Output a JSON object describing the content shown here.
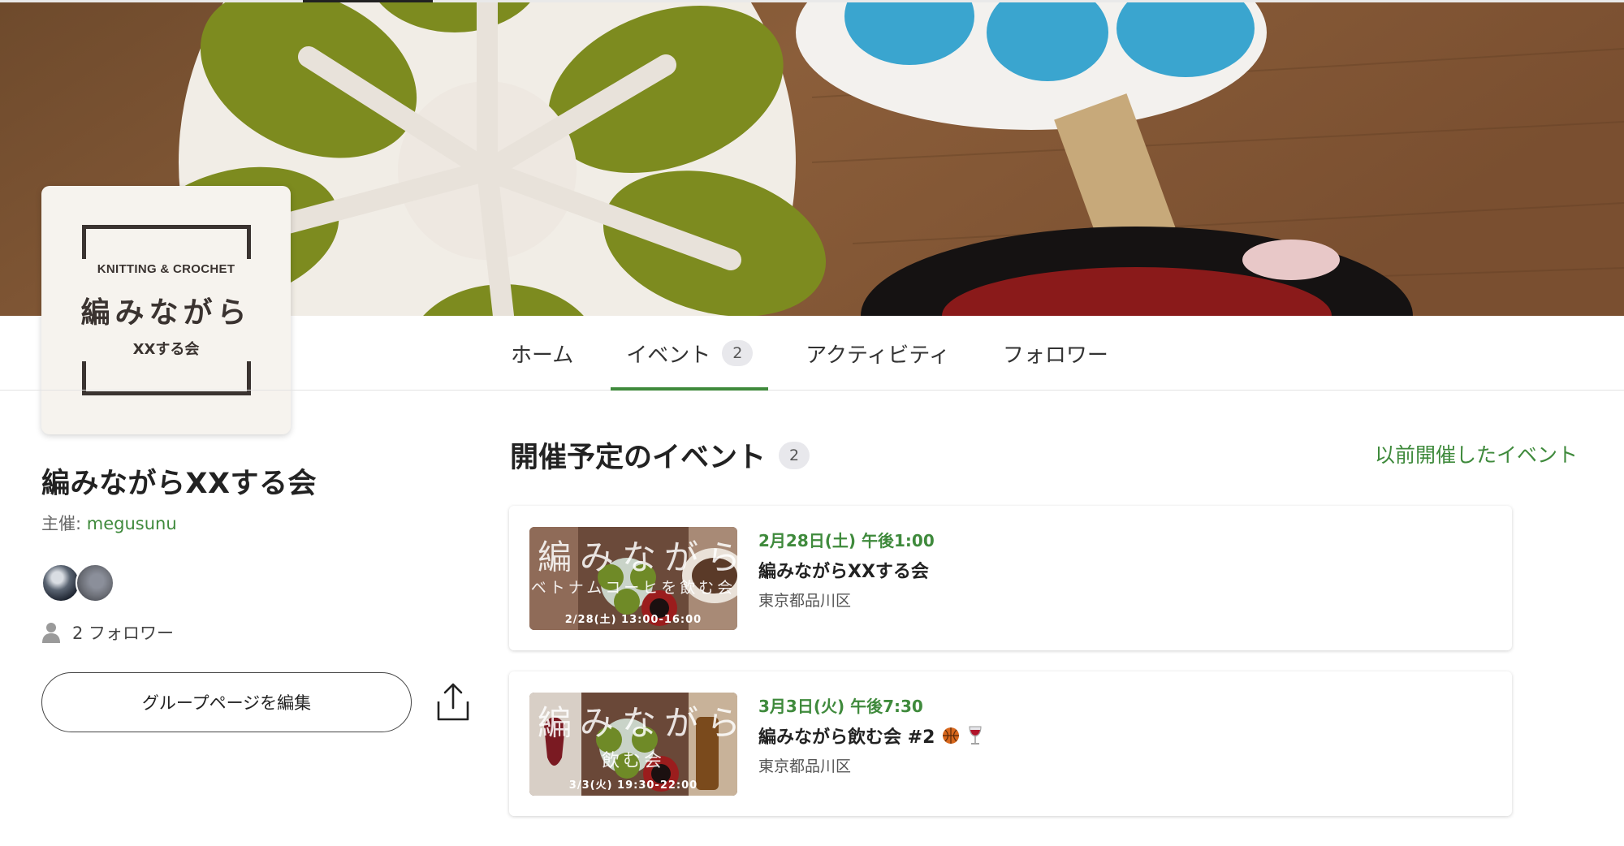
{
  "logo": {
    "line1": "KNITTING & CROCHET",
    "line2": "編みながら",
    "line3": "XXする会"
  },
  "tabs": [
    {
      "label": "ホーム",
      "active": false
    },
    {
      "label": "イベント",
      "badge": "2",
      "active": true
    },
    {
      "label": "アクティビティ",
      "active": false
    },
    {
      "label": "フォロワー",
      "active": false
    }
  ],
  "sidebar": {
    "group_name": "編みながらXXする会",
    "organizer_label": "主催: ",
    "organizer_name": "megusunu",
    "followers_text": "2 フォロワー",
    "edit_button": "グループページを編集",
    "share_icon": "share-icon"
  },
  "main": {
    "section_title": "開催予定のイベント",
    "section_count": "2",
    "past_events_link": "以前開催したイベント"
  },
  "events": [
    {
      "date": "2月28日(土) 午後1:00",
      "title": "編みながらXXする会",
      "location": "東京都品川区",
      "thumb_title": "編みながら",
      "thumb_sub": "ベトナムコーヒを飲む会",
      "thumb_date": "2/28(土) 13:00-16:00"
    },
    {
      "date": "3月3日(火) 午後7:30",
      "title": "編みながら飲む会 #2",
      "location": "東京都品川区",
      "thumb_title": "編みながら",
      "thumb_sub": "飲む会",
      "thumb_date": "3/3(火) 19:30-22:00"
    }
  ],
  "colors": {
    "accent": "#3f8a3c",
    "badge_bg": "#e8e8ec"
  }
}
